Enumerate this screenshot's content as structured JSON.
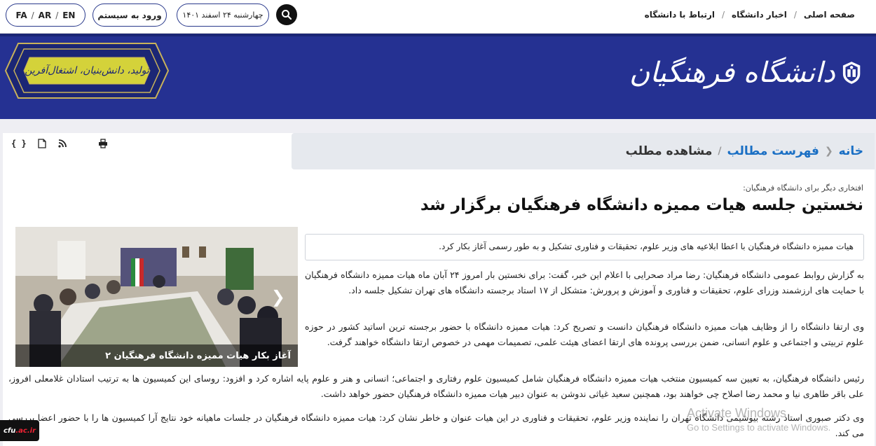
{
  "top_nav": {
    "home": "صفحه اصلی",
    "news": "اخبار دانشگاه",
    "contact": "ارتباط با دانشگاه"
  },
  "date_pill": "چهارشنبه ۲۴ اسفند ۱۴۰۱",
  "login_label": "ورود به سیستم",
  "languages": [
    "FA",
    "AR",
    "EN"
  ],
  "logo_text": "دانشگاه فرهنگیان",
  "slogan": "تولید، دانش‌بنیان، اشتغال‌آفرین",
  "breadcrumb": {
    "home": "خانه",
    "list": "فهرست مطالب",
    "current": "مشاهده مطلب"
  },
  "toolbar_icons": [
    "json-icon",
    "document-icon",
    "rss-icon",
    "print-icon"
  ],
  "article": {
    "pretitle": "افتخاری دیگر برای دانشگاه فرهنگیان:",
    "title": "نخستین جلسه هیات ممیزه دانشگاه فرهنگیان برگزار شد",
    "lead": "هیات ممیزه دانشگاه فرهنگیان با اعطا ابلاعیه های وزیر علوم، تحقیقات و فناوری تشکیل و به طور رسمی آغاز بکار کرد.",
    "paragraphs": [
      "به گزارش روابط عمومی دانشگاه فرهنگیان: رضا مراد صحرایی با اعلام این خبر، گفت: برای نخستین بار امروز ۲۴ آبان ماه هیات ممیزه دانشگاه فرهنگیان با حمایت های ارزشمند وزرای علوم، تحقیقات و فناوری و آموزش و پرورش: متشکل از ۱۷ استاد برجسته دانشگاه های تهران تشکیل جلسه داد.",
      "وی ارتقا دانشگاه را از وظایف هیات ممیزه دانشگاه فرهنگیان دانست و تصریح کرد: هیات ممیزه دانشگاه با حضور برجسته ترین اساتید کشور در حوزه علوم تربیتی و اجتماعی  و علوم انسانی، ضمن بررسی پرونده های ارتقا اعضای هیئت علمی،  تصمیمات مهمی در خصوص ارتقا دانشگاه خواهند گرفت.",
      "رئیس دانشگاه فرهنگیان، به تعیین سه کمیسیون منتخب هیات ممیزه دانشگاه فرهنگیان شامل کمیسیون علوم رفتاری و اجتماعی؛ انسانی و هنر و علوم پایه اشاره کرد و افزود: روسای این کمیسیون ها به ترتیب استادان غلامعلی افروز، علی باقر طاهری نیا و محمد رضا اصلاح چی خواهند بود، همچنین سعید غیاثی ندوشن به عنوان دبیر هیات ممیزه دانشگاه فرهنگیان حضور خواهد داشت.",
      "وی دکتر صبوری استاد رشته بیوشیمی دانشگاه تهران را نماینده وزیر علوم، تحقیقات و فناوری در این هیات عنوان و خاطر نشان کرد:  هیات ممیزه دانشگاه فرهنگیان در جلسات ماهیانه خود نتایج آرا کمیسیون ها را با حضور اعضا بررسی می کند."
    ]
  },
  "slider": {
    "caption": "آغاز بکار هیات ممیزه دانشگاه فرهنگیان ۲",
    "arrow": "❯"
  },
  "watermark": {
    "line1": "Activate Windows",
    "line2": "Go to Settings to activate Windows."
  },
  "site_badge": {
    "prefix": "cfu",
    "suffix": ".ac.ir"
  }
}
